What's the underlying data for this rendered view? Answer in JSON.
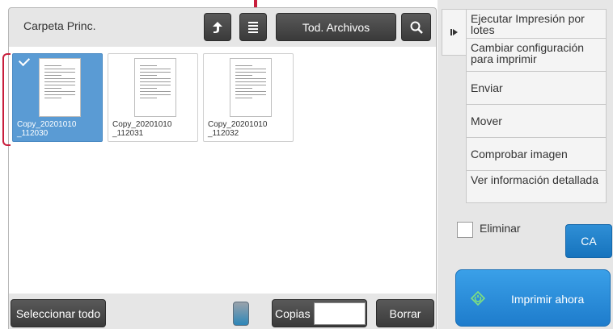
{
  "header": {
    "folder_title": "Carpeta Princ.",
    "all_files_label": "Tod. Archivos"
  },
  "files": [
    {
      "name": "Copy_20201010\n_112030",
      "selected": true
    },
    {
      "name": "Copy_20201010\n_112031",
      "selected": false
    },
    {
      "name": "Copy_20201010\n_112032",
      "selected": false
    }
  ],
  "footer": {
    "select_all_label": "Seleccionar todo",
    "copies_label": "Copias",
    "copies_value": "",
    "delete_label": "Borrar"
  },
  "sidebar": {
    "items": [
      {
        "label": "Ejecutar Impresión por lotes"
      },
      {
        "label": "Cambiar configuración para imprimir"
      },
      {
        "label": "Enviar"
      },
      {
        "label": "Mover"
      },
      {
        "label": "Comprobar imagen"
      },
      {
        "label": "Ver información detallada"
      }
    ],
    "delete_checkbox_label": "Eliminar",
    "ca_label": "CA",
    "print_now_label": "Imprimir ahora"
  },
  "colors": {
    "accent_blue": "#2f8fd6",
    "selected_blue": "#5a9bd4",
    "highlight_red": "#c81e3c"
  }
}
